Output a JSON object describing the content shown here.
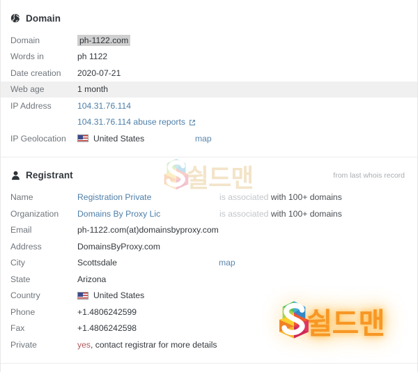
{
  "domain_section": {
    "icon": "globe-icon",
    "title": "Domain",
    "rows": [
      {
        "label": "Domain",
        "value": "ph-1122.com",
        "style": "highlight"
      },
      {
        "label": "Words in",
        "value": "ph 1122",
        "style": "plain"
      },
      {
        "label": "Date creation",
        "value": "2020-07-21",
        "style": "plain"
      },
      {
        "label": "Web age",
        "value": "1 month",
        "style": "plain"
      },
      {
        "label": "IP Address",
        "value": "104.31.76.114",
        "style": "link"
      }
    ],
    "abuse_reports": {
      "text": "104.31.76.114 abuse reports",
      "icon": "external-link-icon"
    },
    "geolocation": {
      "label": "IP Geolocation",
      "flag": "us-flag-icon",
      "country": "United States",
      "map_label": "map"
    }
  },
  "registrant_section": {
    "icon": "person-icon",
    "title": "Registrant",
    "note": "from last whois record",
    "rows": [
      {
        "label": "Name",
        "value": "Registration Private",
        "style": "link",
        "assoc_light": "is associated",
        "assoc_dark": " with 100+ domains"
      },
      {
        "label": "Organization",
        "value": "Domains By Proxy Lic",
        "style": "link",
        "assoc_light": "is associated",
        "assoc_dark": " with 100+ domains"
      },
      {
        "label": "Email",
        "value": "ph-1122.com(at)domainsbyproxy.com",
        "style": "plain"
      },
      {
        "label": "Address",
        "value": "DomainsByProxy.com",
        "style": "plain"
      },
      {
        "label": "City",
        "value": "Scottsdale",
        "style": "plain",
        "map_label": "map"
      },
      {
        "label": "State",
        "value": "Arizona",
        "style": "plain"
      },
      {
        "label": "Country",
        "value": "United States",
        "style": "flag"
      },
      {
        "label": "Phone",
        "value": "+1.4806242599",
        "style": "plain"
      },
      {
        "label": "Fax",
        "value": "+1.4806242598",
        "style": "plain"
      },
      {
        "label": "Private",
        "value_danger": "yes",
        "value_rest": ", contact registrar for more details",
        "style": "danger"
      }
    ]
  },
  "watermarks": {
    "top": {
      "logo": "shieldman-s-logo",
      "text": "쉴드맨"
    },
    "bottom": {
      "logo": "shieldman-s-logo",
      "text": "쉴드맨"
    }
  },
  "colors": {
    "link": "#4d7ea8",
    "label": "#6f757b",
    "value": "#33383d",
    "highlight_bg": "#cfcfcf",
    "danger": "#b05a5a",
    "muted": "#c2c6ca",
    "watermark_orange": "#f7941e"
  }
}
